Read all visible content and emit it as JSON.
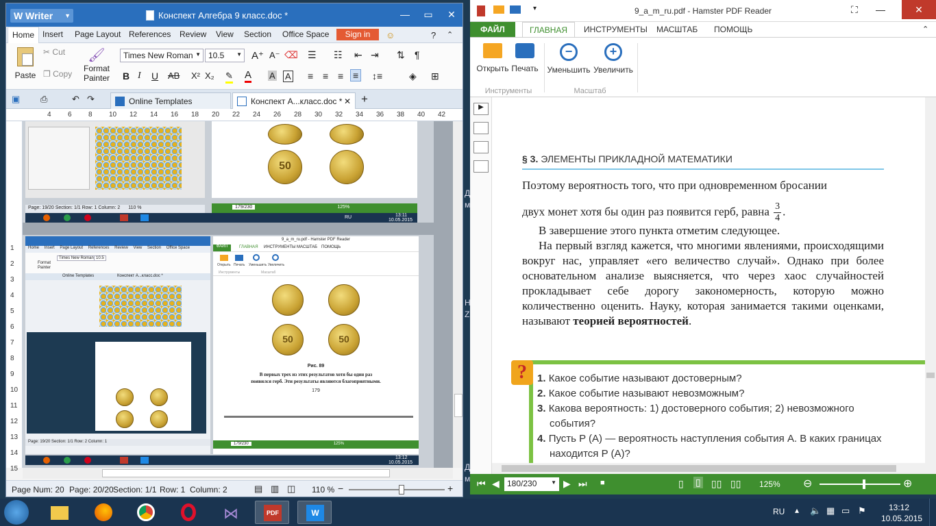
{
  "writer": {
    "app_label": "Writer",
    "doc_title": "Конспект Алгебра 9 класс.doc *",
    "menu": [
      "Home",
      "Insert",
      "Page Layout",
      "References",
      "Review",
      "View",
      "Section",
      "Office Space"
    ],
    "sign_in": "Sign in",
    "clipboard": {
      "paste": "Paste",
      "cut": "Cut",
      "copy": "Copy",
      "format_painter_1": "Format",
      "format_painter_2": "Painter"
    },
    "font_name": "Times New Roman",
    "font_size": "10.5",
    "tabs": {
      "online": "Online Templates",
      "doc": "Конспект А...класс.doc *"
    },
    "ruler": [
      "4",
      "6",
      "8",
      "10",
      "12",
      "14",
      "16",
      "18",
      "20",
      "22",
      "24",
      "26",
      "28",
      "30",
      "32",
      "34",
      "36",
      "38",
      "40",
      "42"
    ],
    "vruler": [
      "1",
      "2",
      "3",
      "4",
      "5",
      "6",
      "7",
      "8",
      "9",
      "10",
      "11",
      "12",
      "13",
      "14",
      "15"
    ],
    "status": {
      "page_num": "Page Num: 20",
      "page": "Page: 20/20",
      "section": "Section: 1/1",
      "row": "Row: 1",
      "column": "Column: 2",
      "zoom": "110 %"
    },
    "zoom_level": 0.55,
    "nested": {
      "status_top": "Page: 19/20   Section: 1/1   Row: 1   Column: 2",
      "zoom_top": "110 %",
      "pdf_page_top": "179/230",
      "pdf_zoom_top": "125%",
      "lang": "RU",
      "time_top": "13:11",
      "date_top": "10.05.2015",
      "title_mid": "9_a_m_ru.pdf - Hamster PDF Reader",
      "tab_file": "ФАЙЛ",
      "tab_main": "ГЛАВНАЯ",
      "tab_tools": "ИНСТРУМЕНТЫ",
      "tab_scale": "МАСШТАБ",
      "tab_help": "ПОМОЩЬ",
      "fig_label": "Рис. 89",
      "fig_text_1": "В первых трех из этих результатов хотя бы один раз",
      "fig_text_2": "появился герб. Эти результаты являются благоприятными.",
      "page_no": "179",
      "status_bottom": "Page: 19/20   Section: 1/1   Row: 2   Column: 1",
      "time_bottom": "13:12",
      "date_bottom": "10.05.2015",
      "coin_value": "50",
      "sub_menu_items": [
        "Home",
        "Insert",
        "Page Layout",
        "References",
        "Review",
        "View",
        "Section",
        "Office Space"
      ],
      "sub_font": "Times New Roman",
      "sub_font_size": "10.5",
      "sub_tab_online": "Online Templates",
      "sub_tab_doc": "Конспект А...класс.doc *",
      "sub_open": "Открыть",
      "sub_print": "Печать",
      "sub_zoomout": "Уменьшить",
      "sub_zoomin": "Увеличить",
      "sub_group_tools": "Инструменты",
      "sub_group_scale": "Масштаб",
      "sub_clip_format": "Format",
      "sub_clip_painter": "Painter"
    }
  },
  "pdf": {
    "title": "9_a_m_ru.pdf - Hamster PDF Reader",
    "tabs": {
      "file": "ФАЙЛ",
      "main": "ГЛАВНАЯ",
      "tools": "ИНСТРУМЕНТЫ",
      "scale": "МАСШТАБ",
      "help": "ПОМОЩЬ"
    },
    "buttons": {
      "open": "Открыть",
      "print": "Печать",
      "zoom_out": "Уменьшить",
      "zoom_in": "Увеличить"
    },
    "groups": {
      "tools": "Инструменты",
      "scale": "Масштаб"
    },
    "section_num": "§ 3.",
    "section_title": "ЭЛЕМЕНТЫ ПРИКЛАДНОЙ МАТЕМАТИКИ",
    "para1_line1": "Поэтому вероятность того, что при одновременном бросании",
    "para1_line2": "двух монет хотя бы один раз появится герб, равна",
    "frac_num": "3",
    "frac_den": "4",
    "para1_end": ".",
    "para2": "В завершение этого пункта отметим следующее.",
    "para3": "На первый взгляд кажется, что многими явлениями, происходящими вокруг нас, управляет «его величество случай». Однако при более основательном анализе выясняется, что через хаос случайностей прокладывает себе дорогу закономерность, которую можно количественно оценить. Науку, которая занимается такими оценками, называют",
    "para3_bold": "теорией вероятностей",
    "para3_end": ".",
    "questions": [
      {
        "n": "1.",
        "text": "Какое событие называют достоверным?"
      },
      {
        "n": "2.",
        "text": "Какое событие называют невозможным?"
      },
      {
        "n": "3.",
        "text": "Какова вероятность: 1) достоверного события; 2) невозможного события?"
      },
      {
        "n": "4.",
        "text": "Пусть P (A) — вероятность наступления события A. В каких границах находится P (A)?"
      }
    ],
    "page_field": "180/230",
    "zoom": "125%",
    "zoom_level": 0.55
  },
  "taskbar": {
    "lang": "RU",
    "time": "13:12",
    "date": "10.05.2015"
  },
  "desktop_labels": [
    "Д",
    "м",
    "Н",
    "Z",
    "Д",
    "м"
  ],
  "colors": {
    "wps_blue": "#2a6fbd",
    "wps_sign": "#e45a33",
    "pdf_green": "#3f8f2f",
    "taskbar": "#1a3450"
  }
}
